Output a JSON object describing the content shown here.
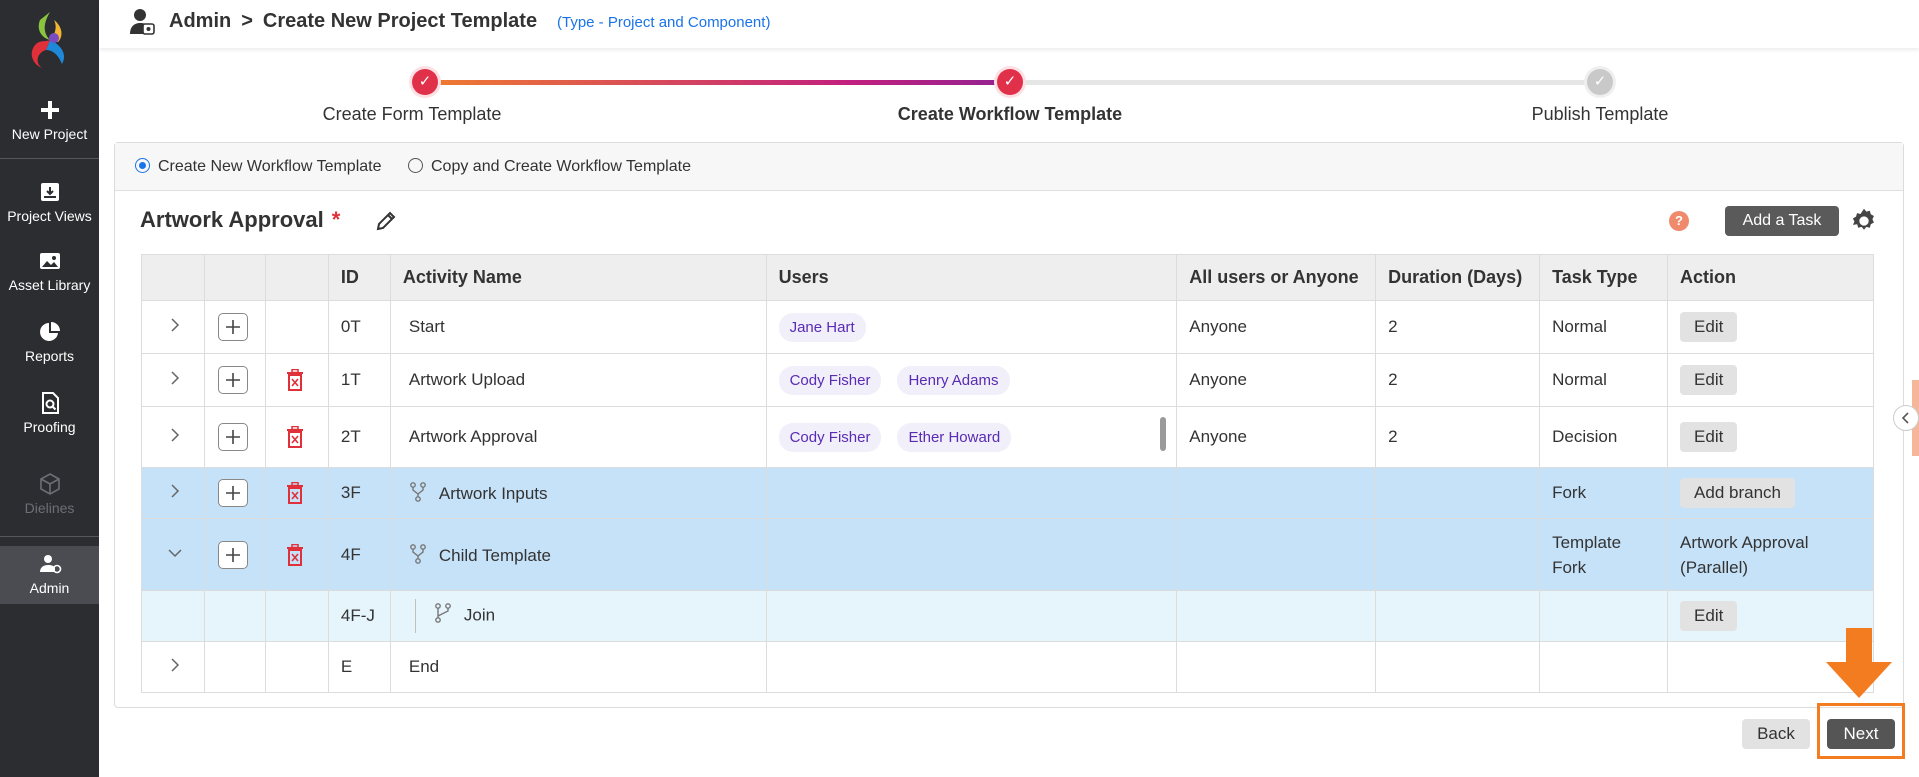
{
  "sidebar": {
    "items": [
      {
        "label": "New Project",
        "icon": "plus-icon"
      },
      {
        "label": "Project Views",
        "icon": "archive-icon"
      },
      {
        "label": "Asset Library",
        "icon": "image-icon"
      },
      {
        "label": "Reports",
        "icon": "pie-chart-icon"
      },
      {
        "label": "Proofing",
        "icon": "document-search-icon"
      },
      {
        "label": "Dielines",
        "icon": "box-icon",
        "disabled": true
      },
      {
        "label": "Admin",
        "icon": "admin-user-icon",
        "active": true
      }
    ]
  },
  "header": {
    "crumb_root": "Admin",
    "crumb_sep": ">",
    "crumb_current": "Create New Project Template",
    "subtype": "(Type - Project and Component)"
  },
  "stepper": {
    "steps": [
      {
        "label": "Create Form Template",
        "state": "done"
      },
      {
        "label": "Create Workflow Template",
        "state": "current"
      },
      {
        "label": "Publish Template",
        "state": "pending"
      }
    ]
  },
  "options": {
    "create_new": "Create New Workflow Template",
    "copy_create": "Copy and Create Workflow Template",
    "selected": "create_new"
  },
  "workflow": {
    "name": "Artwork Approval",
    "required_mark": "*",
    "help": "?",
    "add_task_label": "Add a Task"
  },
  "table": {
    "headers": [
      "ID",
      "Activity Name",
      "Users",
      "All users or Anyone",
      "Duration (Days)",
      "Task Type",
      "Action"
    ],
    "rows": [
      {
        "id": "0T",
        "name": "Start",
        "users": [
          "Jane Hart"
        ],
        "who": "Anyone",
        "duration": "2",
        "type": "Normal",
        "action": "Edit"
      },
      {
        "id": "1T",
        "name": "Artwork Upload",
        "users": [
          "Cody Fisher",
          "Henry Adams"
        ],
        "who": "Anyone",
        "duration": "2",
        "type": "Normal",
        "action": "Edit"
      },
      {
        "id": "2T",
        "name": "Artwork Approval",
        "users": [
          "Cody Fisher",
          "Ether Howard"
        ],
        "who": "Anyone",
        "duration": "2",
        "type": "Decision",
        "action": "Edit"
      },
      {
        "id": "3F",
        "name": "Artwork Inputs",
        "type": "Fork",
        "action": "Add branch"
      },
      {
        "id": "4F",
        "name": "Child Template",
        "type_line1": "Template",
        "type_line2": "Fork",
        "action_line1": "Artwork Approval",
        "action_line2": "(Parallel)"
      },
      {
        "id": "4F-J",
        "name": "Join",
        "action": "Edit"
      },
      {
        "id": "E",
        "name": "End"
      }
    ]
  },
  "footer": {
    "back_label": "Back",
    "next_label": "Next"
  },
  "colors": {
    "sidebar_bg": "#2b2d31",
    "accent_blue": "#1a73e8",
    "highlight_row": "#c6e2f8",
    "chip_text": "#5a2bb3",
    "callout_orange": "#f47c20",
    "delete_red": "#e0303a"
  }
}
